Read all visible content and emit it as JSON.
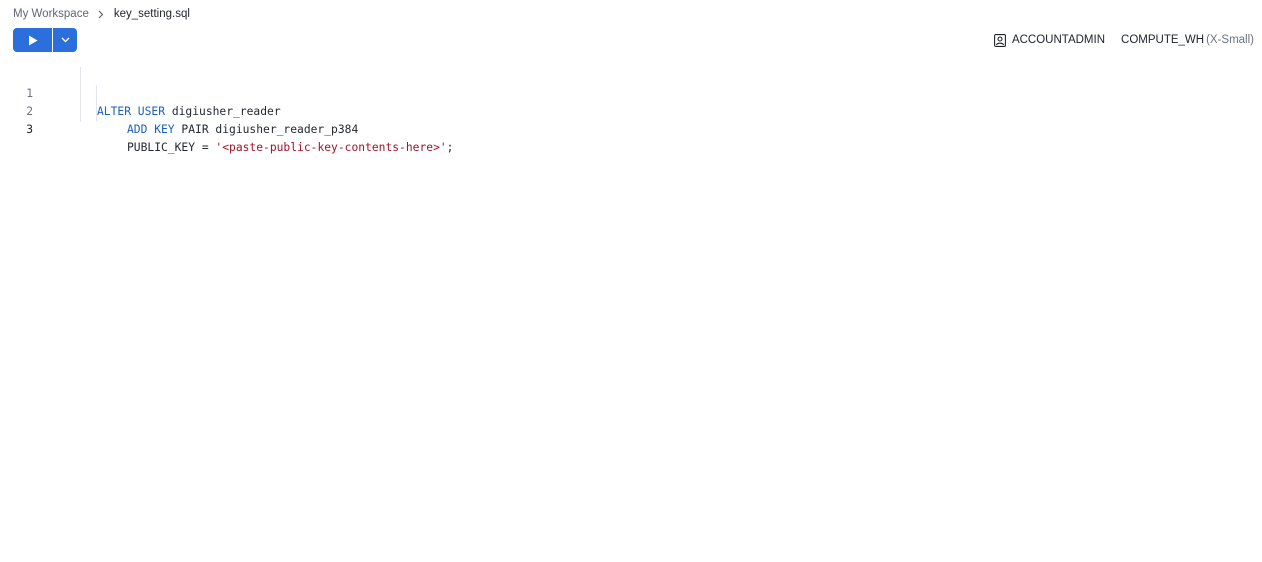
{
  "breadcrumb": {
    "workspace": "My Workspace",
    "file": "key_setting.sql"
  },
  "toolbar": {
    "run_icon": "play-icon",
    "run_menu_icon": "chevron-down-icon"
  },
  "context": {
    "role_icon": "user-badge-icon",
    "role": "ACCOUNTADMIN",
    "warehouse": "COMPUTE_WH",
    "warehouse_size": "(X-Small)"
  },
  "editor": {
    "lines": [
      {
        "number": "1",
        "tokens": [
          {
            "text": "ALTER USER",
            "type": "keyword"
          },
          {
            "text": " digiusher_reader",
            "type": "plain"
          }
        ]
      },
      {
        "number": "2",
        "tokens": [
          {
            "text": "ADD KEY",
            "type": "keyword"
          },
          {
            "text": " PAIR digiusher_reader_p384",
            "type": "plain"
          }
        ]
      },
      {
        "number": "3",
        "tokens": [
          {
            "text": "PUBLIC_KEY = ",
            "type": "plain"
          },
          {
            "text": "'<paste-public-key-contents-here>'",
            "type": "string"
          },
          {
            "text": ";",
            "type": "plain"
          }
        ]
      }
    ],
    "active_line": "3"
  },
  "colors": {
    "accent": "#2a6fdb",
    "keyword": "#1a5fc0",
    "string": "#a0142c"
  }
}
